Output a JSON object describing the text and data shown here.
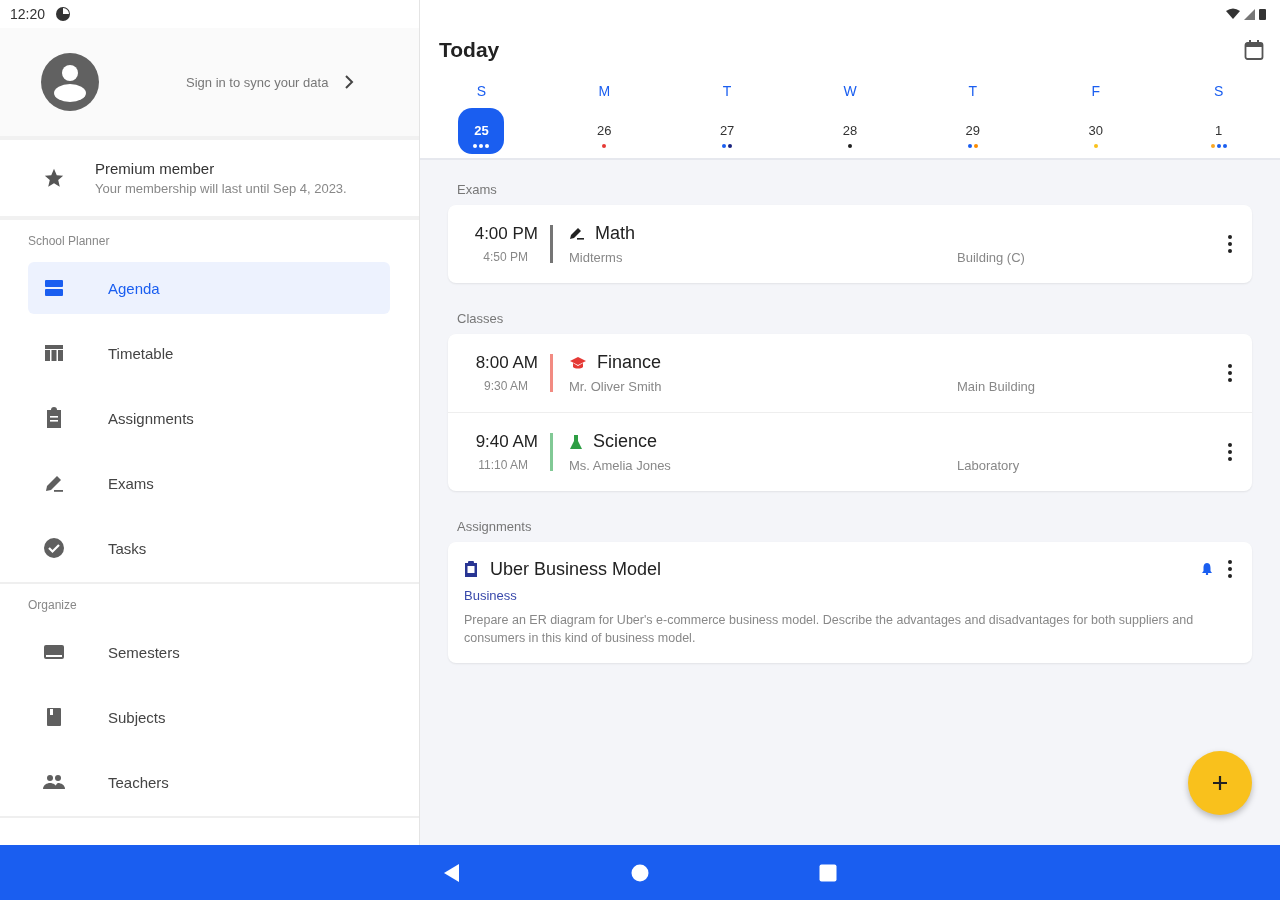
{
  "status_bar": {
    "time": "12:20"
  },
  "drawer": {
    "sign_in": "Sign in to sync your data",
    "premium": {
      "title": "Premium member",
      "subtitle": "Your membership will last until Sep 4, 2023."
    },
    "sections": [
      {
        "label": "School Planner",
        "items": [
          {
            "label": "Agenda",
            "selected": true
          },
          {
            "label": "Timetable",
            "selected": false
          },
          {
            "label": "Assignments",
            "selected": false
          },
          {
            "label": "Exams",
            "selected": false
          },
          {
            "label": "Tasks",
            "selected": false
          }
        ]
      },
      {
        "label": "Organize",
        "items": [
          {
            "label": "Semesters",
            "selected": false
          },
          {
            "label": "Subjects",
            "selected": false
          },
          {
            "label": "Teachers",
            "selected": false
          }
        ]
      }
    ]
  },
  "agenda": {
    "title": "Today",
    "days": [
      {
        "weekday": "S",
        "date": "25",
        "selected": true,
        "dots": [
          {
            "color": "#ffffff"
          },
          {
            "color": "#ffffff"
          },
          {
            "color": "#ffffff"
          }
        ]
      },
      {
        "weekday": "M",
        "date": "26",
        "selected": false,
        "dots": [
          {
            "color": "#e53935"
          }
        ]
      },
      {
        "weekday": "T",
        "date": "27",
        "selected": false,
        "dots": [
          {
            "color": "#1a5ef0"
          },
          {
            "color": "#1a237e"
          }
        ]
      },
      {
        "weekday": "W",
        "date": "28",
        "selected": false,
        "dots": [
          {
            "color": "#212121"
          }
        ]
      },
      {
        "weekday": "T",
        "date": "29",
        "selected": false,
        "dots": [
          {
            "color": "#1a5ef0"
          },
          {
            "color": "#fb8c00"
          }
        ]
      },
      {
        "weekday": "F",
        "date": "30",
        "selected": false,
        "dots": [
          {
            "color": "#f9c11c"
          }
        ]
      },
      {
        "weekday": "S",
        "date": "1",
        "selected": false,
        "dots": [
          {
            "color": "#f9a825"
          },
          {
            "color": "#1a5ef0"
          },
          {
            "color": "#1a5ef0"
          }
        ]
      }
    ],
    "groups": [
      {
        "label": "Exams",
        "events": [
          {
            "kind": "exam",
            "start": "4:00 PM",
            "end": "4:50 PM",
            "title": "Math",
            "subtitle": "Midterms",
            "location": "Building (C)",
            "color": "#757575"
          }
        ]
      },
      {
        "label": "Classes",
        "events": [
          {
            "kind": "class",
            "start": "8:00 AM",
            "end": "9:30 AM",
            "title": "Finance",
            "subtitle": "Mr. Oliver Smith",
            "location": "Main Building",
            "color": "#f28b82"
          },
          {
            "kind": "lab",
            "start": "9:40 AM",
            "end": "11:10 AM",
            "title": "Science",
            "subtitle": "Ms. Amelia Jones",
            "location": "Laboratory",
            "color": "#81c995"
          }
        ]
      }
    ],
    "assignments_label": "Assignments",
    "assignment": {
      "title": "Uber Business Model",
      "subject": "Business",
      "description": "Prepare an ER diagram for Uber's e-commerce business model. Describe the advantages and disadvantages for both suppliers and consumers in this kind of business model.",
      "reminder": true
    }
  }
}
